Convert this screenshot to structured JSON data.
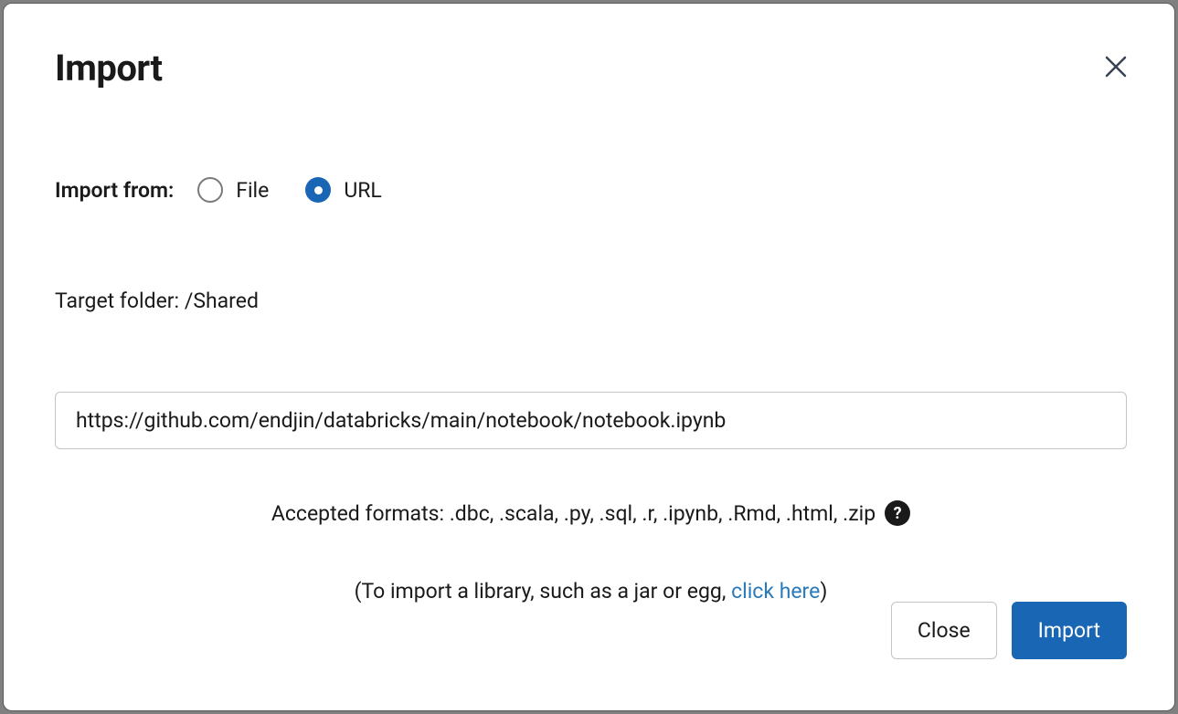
{
  "dialog": {
    "title": "Import",
    "import_from_label": "Import from:",
    "radio_file_label": "File",
    "radio_url_label": "URL",
    "target_folder_label": "Target folder: ",
    "target_folder_value": "/Shared",
    "url_input_value": "https://github.com/endjin/databricks/main/notebook/notebook.ipynb",
    "accepted_formats_text": "Accepted formats: .dbc, .scala, .py, .sql, .r, .ipynb, .Rmd, .html, .zip",
    "help_icon_label": "?",
    "library_hint_prefix": "(To import a library, such as a jar or egg, ",
    "library_hint_link": "click here",
    "library_hint_suffix": ")",
    "close_button_label": "Close",
    "import_button_label": "Import"
  }
}
